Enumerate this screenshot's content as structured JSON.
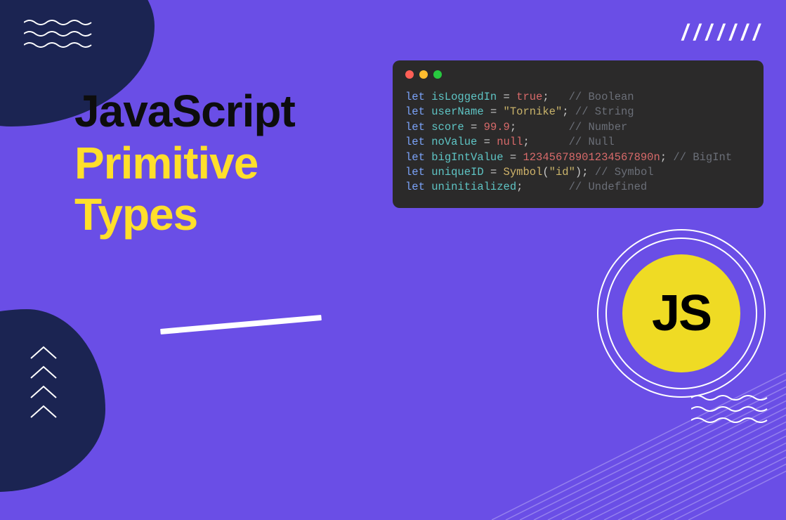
{
  "headline": {
    "line1": "JavaScript",
    "line2": "Primitive",
    "line3": "Types"
  },
  "slashes": "///////",
  "js_badge_text": "JS",
  "code": {
    "lines": [
      {
        "kw": "let",
        "var": "isLoggedIn",
        "op1": " = ",
        "val": "true",
        "valClass": "bool",
        "tail": ";",
        "pad": "   ",
        "comment": "// Boolean"
      },
      {
        "kw": "let",
        "var": "userName",
        "op1": " = ",
        "val": "\"Tornike\"",
        "valClass": "str",
        "tail": ";",
        "pad": " ",
        "comment": "// String"
      },
      {
        "kw": "let",
        "var": "score",
        "op1": " = ",
        "val": "99.9",
        "valClass": "num",
        "tail": ";",
        "pad": "        ",
        "comment": "// Number"
      },
      {
        "kw": "let",
        "var": "noValue",
        "op1": " = ",
        "val": "null",
        "valClass": "null",
        "tail": ";",
        "pad": "      ",
        "comment": "// Null"
      },
      {
        "kw": "let",
        "var": "bigIntValue",
        "op1": " = ",
        "val": "12345678901234567890n",
        "valClass": "bigint",
        "tail": ";",
        "pad": " ",
        "comment": "// BigInt"
      },
      {
        "kw": "let",
        "var": "uniqueID",
        "op1": " = ",
        "fn": "Symbol",
        "paren1": "(",
        "arg": "\"id\"",
        "paren2": ")",
        "tail": ";",
        "pad": " ",
        "comment": "// Symbol"
      },
      {
        "kw": "let",
        "var": "uninitialized",
        "op1": "",
        "val": "",
        "valClass": "",
        "tail": ";",
        "pad": "       ",
        "comment": "// Undefined"
      }
    ]
  }
}
